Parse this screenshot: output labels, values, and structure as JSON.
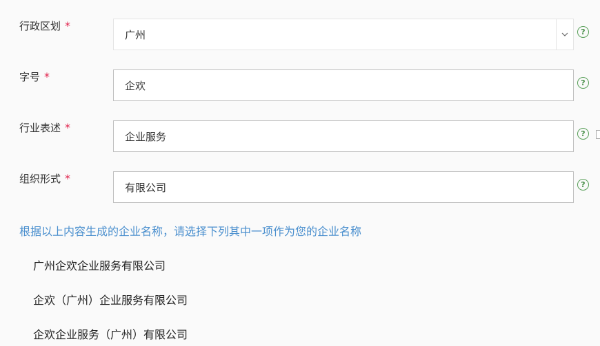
{
  "form": {
    "region": {
      "label": "行政区划",
      "required_mark": "*",
      "value": "广州"
    },
    "trade_name": {
      "label": "字号",
      "required_mark": "*",
      "value": "企欢"
    },
    "industry": {
      "label": "行业表述",
      "required_mark": "*",
      "value": "企业服务"
    },
    "org_form": {
      "label": "组织形式",
      "required_mark": "*",
      "value": "有限公司"
    },
    "help_symbol": "?"
  },
  "suggestions": {
    "hint": "根据以上内容生成的企业名称，请选择下列其中一项作为您的企业名称",
    "options": [
      "广州企欢企业服务有限公司",
      "企欢（广州）企业服务有限公司",
      "企欢企业服务（广州）有限公司"
    ]
  },
  "colors": {
    "required": "#e0204a",
    "hint": "#4a8fce",
    "help_icon": "#5aa05a"
  }
}
